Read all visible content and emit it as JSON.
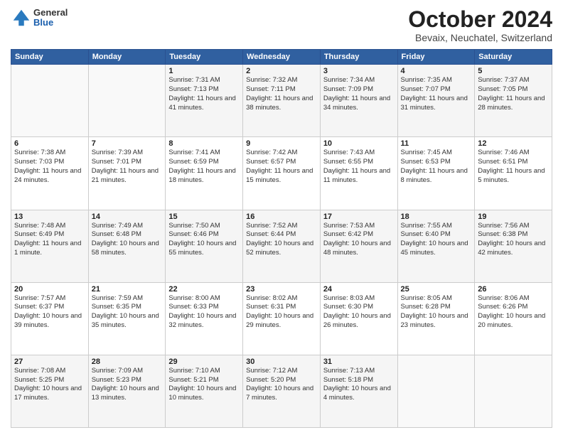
{
  "header": {
    "logo": {
      "general": "General",
      "blue": "Blue"
    },
    "title": "October 2024",
    "subtitle": "Bevaix, Neuchatel, Switzerland"
  },
  "days_of_week": [
    "Sunday",
    "Monday",
    "Tuesday",
    "Wednesday",
    "Thursday",
    "Friday",
    "Saturday"
  ],
  "weeks": [
    [
      {
        "day": "",
        "sunrise": "",
        "sunset": "",
        "daylight": ""
      },
      {
        "day": "",
        "sunrise": "",
        "sunset": "",
        "daylight": ""
      },
      {
        "day": "1",
        "sunrise": "Sunrise: 7:31 AM",
        "sunset": "Sunset: 7:13 PM",
        "daylight": "Daylight: 11 hours and 41 minutes."
      },
      {
        "day": "2",
        "sunrise": "Sunrise: 7:32 AM",
        "sunset": "Sunset: 7:11 PM",
        "daylight": "Daylight: 11 hours and 38 minutes."
      },
      {
        "day": "3",
        "sunrise": "Sunrise: 7:34 AM",
        "sunset": "Sunset: 7:09 PM",
        "daylight": "Daylight: 11 hours and 34 minutes."
      },
      {
        "day": "4",
        "sunrise": "Sunrise: 7:35 AM",
        "sunset": "Sunset: 7:07 PM",
        "daylight": "Daylight: 11 hours and 31 minutes."
      },
      {
        "day": "5",
        "sunrise": "Sunrise: 7:37 AM",
        "sunset": "Sunset: 7:05 PM",
        "daylight": "Daylight: 11 hours and 28 minutes."
      }
    ],
    [
      {
        "day": "6",
        "sunrise": "Sunrise: 7:38 AM",
        "sunset": "Sunset: 7:03 PM",
        "daylight": "Daylight: 11 hours and 24 minutes."
      },
      {
        "day": "7",
        "sunrise": "Sunrise: 7:39 AM",
        "sunset": "Sunset: 7:01 PM",
        "daylight": "Daylight: 11 hours and 21 minutes."
      },
      {
        "day": "8",
        "sunrise": "Sunrise: 7:41 AM",
        "sunset": "Sunset: 6:59 PM",
        "daylight": "Daylight: 11 hours and 18 minutes."
      },
      {
        "day": "9",
        "sunrise": "Sunrise: 7:42 AM",
        "sunset": "Sunset: 6:57 PM",
        "daylight": "Daylight: 11 hours and 15 minutes."
      },
      {
        "day": "10",
        "sunrise": "Sunrise: 7:43 AM",
        "sunset": "Sunset: 6:55 PM",
        "daylight": "Daylight: 11 hours and 11 minutes."
      },
      {
        "day": "11",
        "sunrise": "Sunrise: 7:45 AM",
        "sunset": "Sunset: 6:53 PM",
        "daylight": "Daylight: 11 hours and 8 minutes."
      },
      {
        "day": "12",
        "sunrise": "Sunrise: 7:46 AM",
        "sunset": "Sunset: 6:51 PM",
        "daylight": "Daylight: 11 hours and 5 minutes."
      }
    ],
    [
      {
        "day": "13",
        "sunrise": "Sunrise: 7:48 AM",
        "sunset": "Sunset: 6:49 PM",
        "daylight": "Daylight: 11 hours and 1 minute."
      },
      {
        "day": "14",
        "sunrise": "Sunrise: 7:49 AM",
        "sunset": "Sunset: 6:48 PM",
        "daylight": "Daylight: 10 hours and 58 minutes."
      },
      {
        "day": "15",
        "sunrise": "Sunrise: 7:50 AM",
        "sunset": "Sunset: 6:46 PM",
        "daylight": "Daylight: 10 hours and 55 minutes."
      },
      {
        "day": "16",
        "sunrise": "Sunrise: 7:52 AM",
        "sunset": "Sunset: 6:44 PM",
        "daylight": "Daylight: 10 hours and 52 minutes."
      },
      {
        "day": "17",
        "sunrise": "Sunrise: 7:53 AM",
        "sunset": "Sunset: 6:42 PM",
        "daylight": "Daylight: 10 hours and 48 minutes."
      },
      {
        "day": "18",
        "sunrise": "Sunrise: 7:55 AM",
        "sunset": "Sunset: 6:40 PM",
        "daylight": "Daylight: 10 hours and 45 minutes."
      },
      {
        "day": "19",
        "sunrise": "Sunrise: 7:56 AM",
        "sunset": "Sunset: 6:38 PM",
        "daylight": "Daylight: 10 hours and 42 minutes."
      }
    ],
    [
      {
        "day": "20",
        "sunrise": "Sunrise: 7:57 AM",
        "sunset": "Sunset: 6:37 PM",
        "daylight": "Daylight: 10 hours and 39 minutes."
      },
      {
        "day": "21",
        "sunrise": "Sunrise: 7:59 AM",
        "sunset": "Sunset: 6:35 PM",
        "daylight": "Daylight: 10 hours and 35 minutes."
      },
      {
        "day": "22",
        "sunrise": "Sunrise: 8:00 AM",
        "sunset": "Sunset: 6:33 PM",
        "daylight": "Daylight: 10 hours and 32 minutes."
      },
      {
        "day": "23",
        "sunrise": "Sunrise: 8:02 AM",
        "sunset": "Sunset: 6:31 PM",
        "daylight": "Daylight: 10 hours and 29 minutes."
      },
      {
        "day": "24",
        "sunrise": "Sunrise: 8:03 AM",
        "sunset": "Sunset: 6:30 PM",
        "daylight": "Daylight: 10 hours and 26 minutes."
      },
      {
        "day": "25",
        "sunrise": "Sunrise: 8:05 AM",
        "sunset": "Sunset: 6:28 PM",
        "daylight": "Daylight: 10 hours and 23 minutes."
      },
      {
        "day": "26",
        "sunrise": "Sunrise: 8:06 AM",
        "sunset": "Sunset: 6:26 PM",
        "daylight": "Daylight: 10 hours and 20 minutes."
      }
    ],
    [
      {
        "day": "27",
        "sunrise": "Sunrise: 7:08 AM",
        "sunset": "Sunset: 5:25 PM",
        "daylight": "Daylight: 10 hours and 17 minutes."
      },
      {
        "day": "28",
        "sunrise": "Sunrise: 7:09 AM",
        "sunset": "Sunset: 5:23 PM",
        "daylight": "Daylight: 10 hours and 13 minutes."
      },
      {
        "day": "29",
        "sunrise": "Sunrise: 7:10 AM",
        "sunset": "Sunset: 5:21 PM",
        "daylight": "Daylight: 10 hours and 10 minutes."
      },
      {
        "day": "30",
        "sunrise": "Sunrise: 7:12 AM",
        "sunset": "Sunset: 5:20 PM",
        "daylight": "Daylight: 10 hours and 7 minutes."
      },
      {
        "day": "31",
        "sunrise": "Sunrise: 7:13 AM",
        "sunset": "Sunset: 5:18 PM",
        "daylight": "Daylight: 10 hours and 4 minutes."
      },
      {
        "day": "",
        "sunrise": "",
        "sunset": "",
        "daylight": ""
      },
      {
        "day": "",
        "sunrise": "",
        "sunset": "",
        "daylight": ""
      }
    ]
  ]
}
